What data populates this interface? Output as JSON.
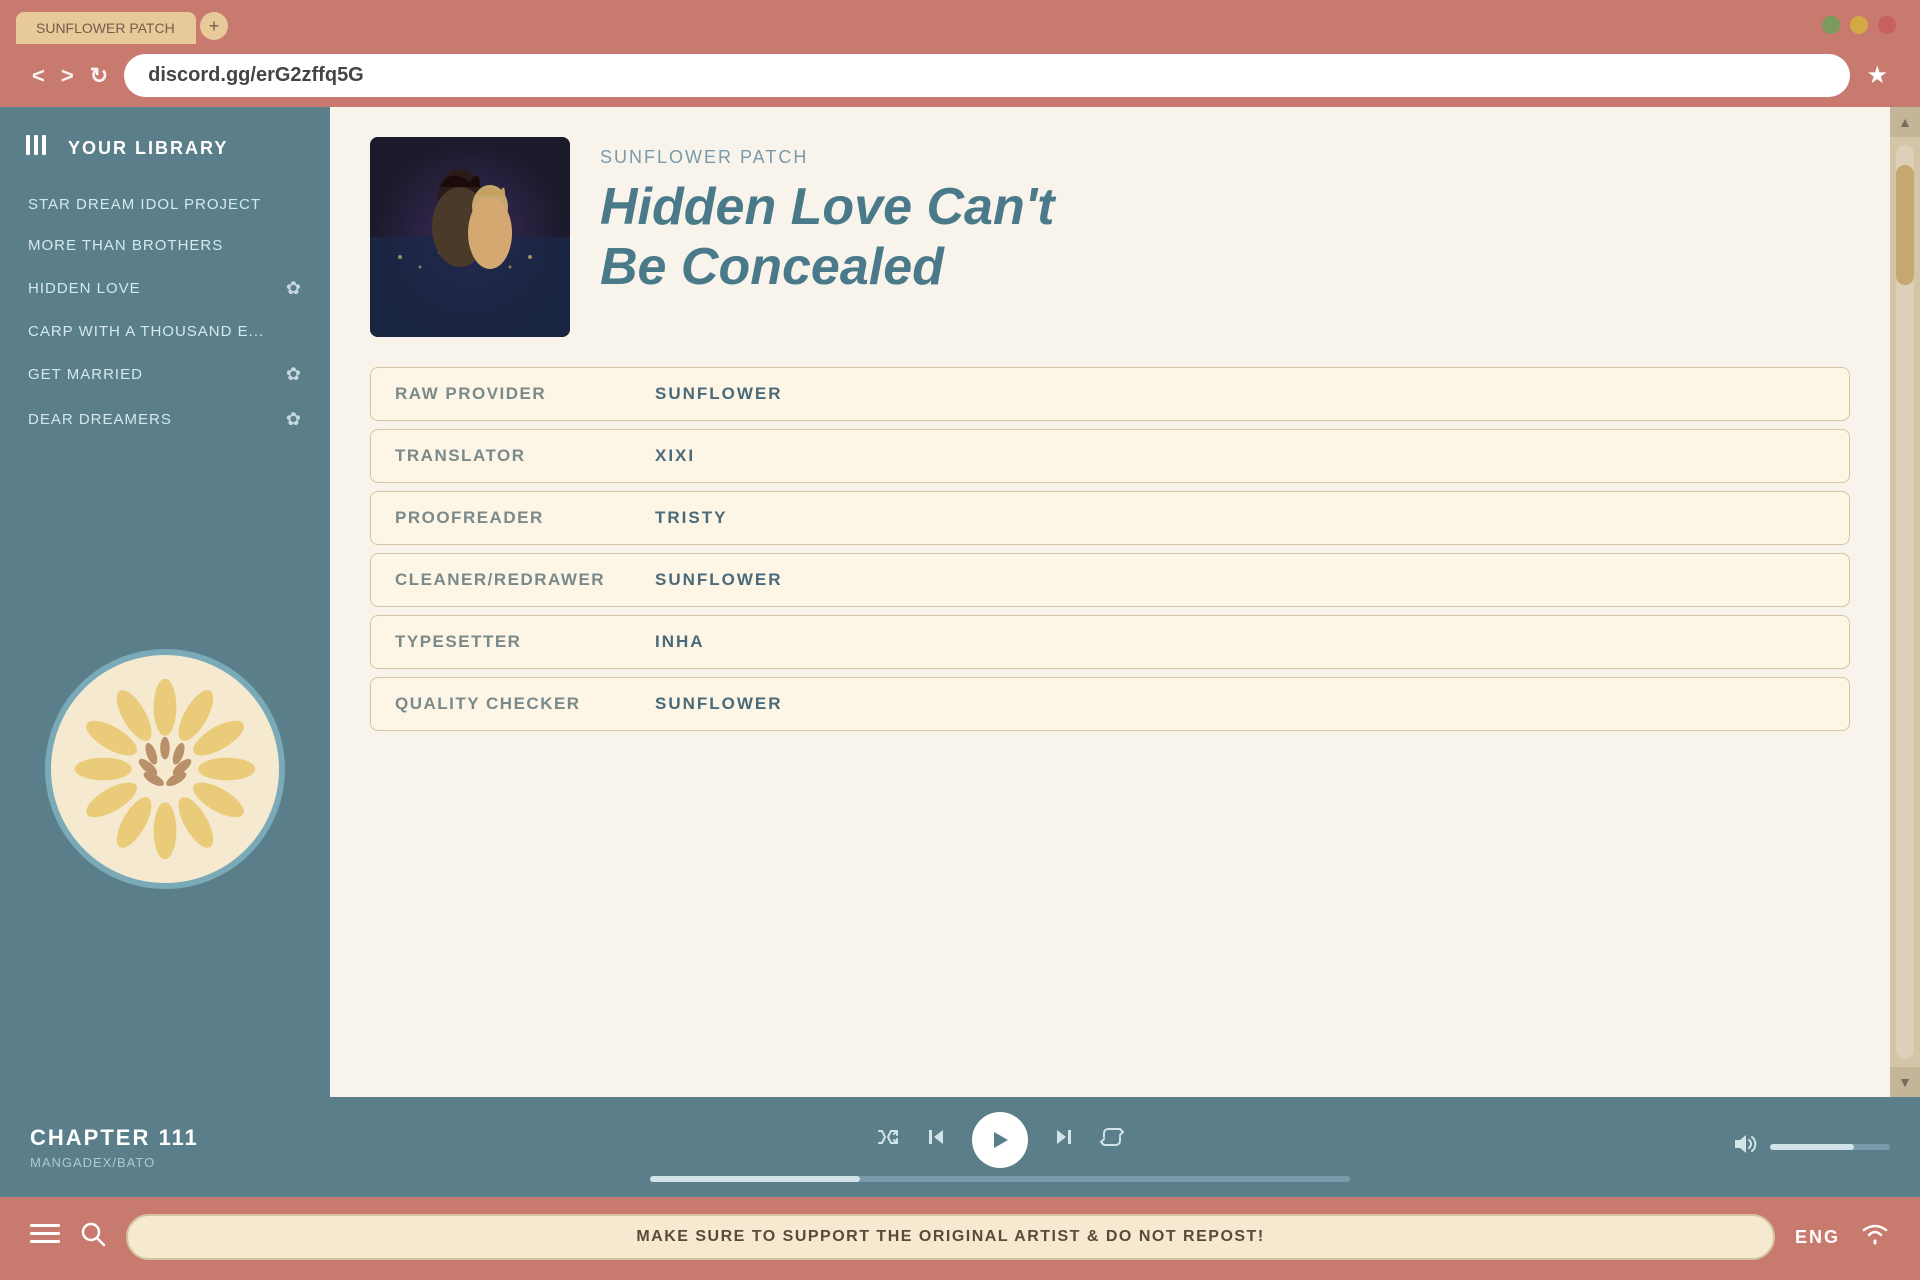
{
  "browser": {
    "tab_label": "SUNFLOWER PATCH",
    "tab_add": "+",
    "url": "discord.gg/erG2zffq5G",
    "back_label": "<",
    "forward_label": ">",
    "refresh_label": "↻",
    "bookmark_label": "★"
  },
  "sidebar": {
    "library_title": "YOUR LIBRARY",
    "items": [
      {
        "label": "STAR DREAM IDOL PROJECT",
        "starred": false
      },
      {
        "label": "MORE THAN BROTHERS",
        "starred": false
      },
      {
        "label": "HIDDEN LOVE",
        "starred": true
      },
      {
        "label": "CARP WITH A THOUSAND E...",
        "starred": false
      },
      {
        "label": "GET MARRIED",
        "starred": true
      },
      {
        "label": "DEAR DREAMERS",
        "starred": true
      }
    ]
  },
  "manga": {
    "publisher": "SUNFLOWER PATCH",
    "title_line1": "Hidden Love Can't",
    "title_line2": "Be Concealed",
    "credits": [
      {
        "label": "RAW PROVIDER",
        "value": "SUNFLOWER"
      },
      {
        "label": "TRANSLATOR",
        "value": "XIXI"
      },
      {
        "label": "PROOFREADER",
        "value": "TRISTY"
      },
      {
        "label": "CLEANER/REDRAWER",
        "value": "SUNFLOWER"
      },
      {
        "label": "TYPESETTER",
        "value": "INHA"
      },
      {
        "label": "QUALITY CHECKER",
        "value": "SUNFLOWER"
      }
    ]
  },
  "player": {
    "chapter": "CHAPTER 111",
    "source": "MANGADEX/BATO",
    "shuffle_icon": "⇄",
    "prev_icon": "⏮",
    "play_icon": "▶",
    "next_icon": "⏭",
    "repeat_icon": "↻",
    "volume_icon": "🔊"
  },
  "bottom_bar": {
    "message": "MAKE SURE TO SUPPORT THE ORIGINAL ARTIST & DO NOT REPOST!",
    "language": "ENG"
  },
  "window_controls": {
    "green": "●",
    "yellow": "●",
    "red": "●"
  }
}
